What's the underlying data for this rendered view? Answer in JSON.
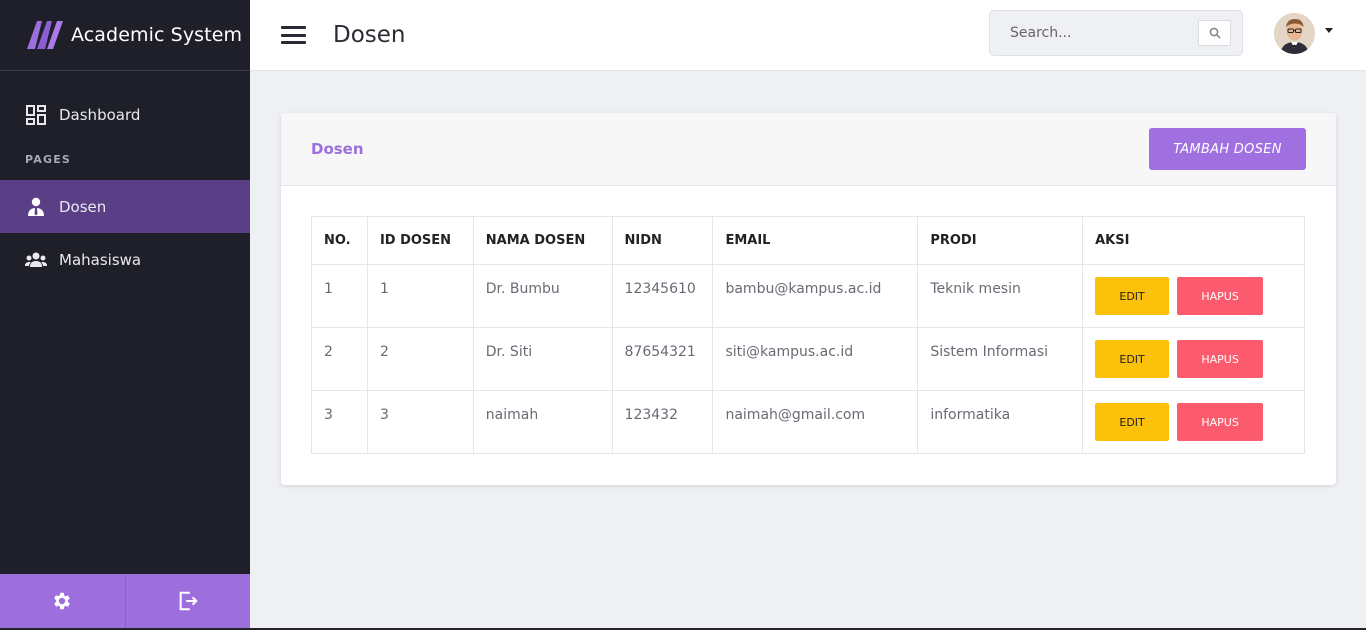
{
  "brand": {
    "name": "Academic System"
  },
  "sidebar": {
    "items": [
      {
        "label": "Dashboard",
        "icon": "dashboard-grid-icon"
      },
      {
        "label": "Dosen",
        "icon": "user-tie-icon",
        "active": true
      },
      {
        "label": "Mahasiswa",
        "icon": "users-icon"
      }
    ],
    "section_label": "PAGES",
    "footer": {
      "settings_icon": "gear-icon",
      "logout_icon": "logout-icon"
    }
  },
  "header": {
    "title": "Dosen",
    "search_placeholder": "Search...",
    "search_icon": "search-icon"
  },
  "card": {
    "title": "Dosen",
    "add_button": "TAMBAH DOSEN"
  },
  "table": {
    "columns": [
      "NO.",
      "ID DOSEN",
      "NAMA DOSEN",
      "NIDN",
      "EMAIL",
      "PRODI",
      "AKSI"
    ],
    "rows": [
      {
        "no": "1",
        "id": "1",
        "nama": "Dr. Bumbu",
        "nidn": "12345610",
        "email": "bambu@kampus.ac.id",
        "prodi": "Teknik mesin",
        "edit": "EDIT",
        "hapus": "HAPUS"
      },
      {
        "no": "2",
        "id": "2",
        "nama": "Dr. Siti",
        "nidn": "87654321",
        "email": "siti@kampus.ac.id",
        "prodi": "Sistem Informasi",
        "edit": "EDIT",
        "hapus": "HAPUS"
      },
      {
        "no": "3",
        "id": "3",
        "nama": "naimah",
        "nidn": "123432",
        "email": "naimah@gmail.com",
        "prodi": "informatika",
        "edit": "EDIT",
        "hapus": "HAPUS"
      }
    ]
  },
  "colors": {
    "sidebar_bg": "#1e1f29",
    "active_item": "#5a3f86",
    "accent": "#a06fe0",
    "edit_button": "#fcc10b",
    "delete_button": "#fc5a6d"
  }
}
